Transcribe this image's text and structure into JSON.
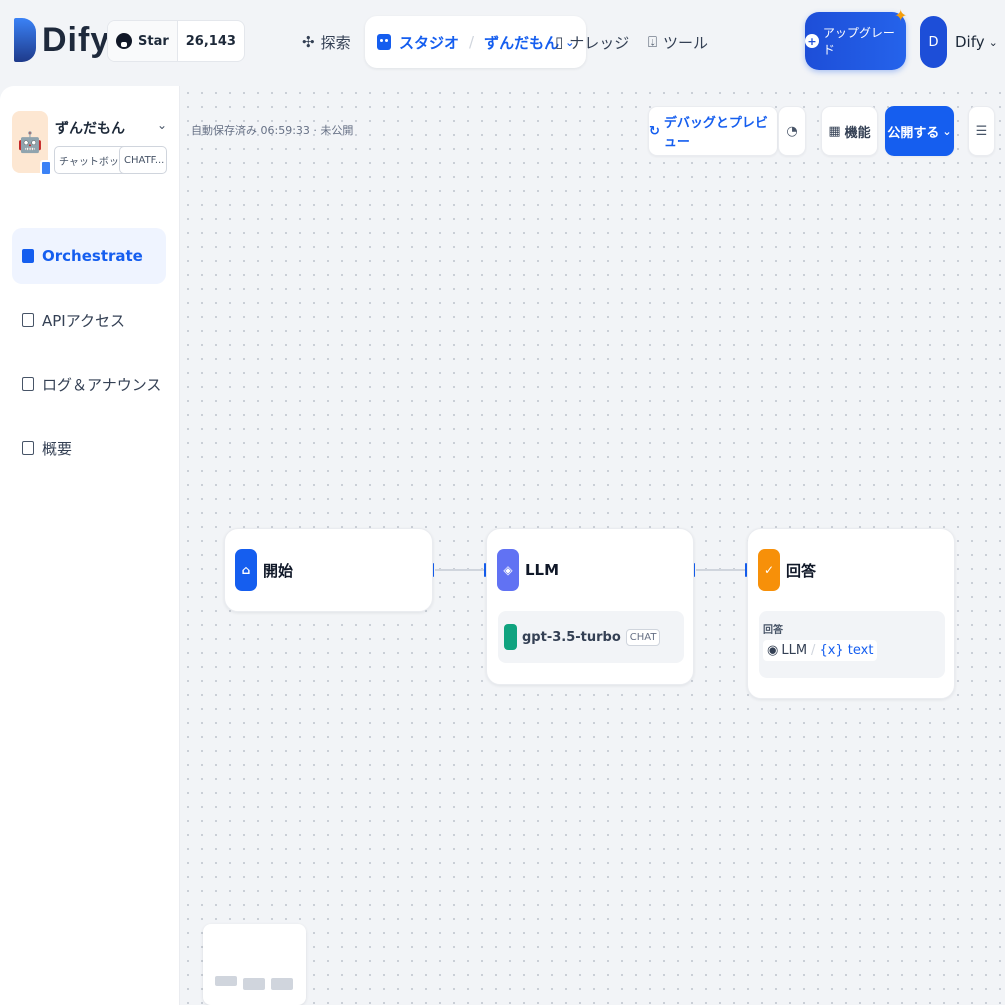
{
  "header": {
    "logo_text": "Dify",
    "github": {
      "star_label": "Star",
      "count": "26,143"
    },
    "nav": {
      "explore": "探索",
      "studio": "スタジオ",
      "studio_app": "ずんだもん",
      "knowledge": "ナレッジ",
      "tools": "ツール"
    },
    "upgrade_label": "アップグレード",
    "account": {
      "initial": "D",
      "name": "Dify"
    }
  },
  "sidebar": {
    "app_name": "ずんだもん",
    "app_type": "チャットボット",
    "app_mode": "CHATF...",
    "items": [
      {
        "label": "Orchestrate",
        "active": true
      },
      {
        "label": "APIアクセス",
        "active": false
      },
      {
        "label": "ログ＆アナウンス",
        "active": false
      },
      {
        "label": "概要",
        "active": false
      }
    ]
  },
  "toolbar": {
    "autosave": "自動保存済み 06:59:33 · 未公開",
    "debug_label": "デバッグとプレビュー",
    "features_label": "機能",
    "publish_label": "公開する"
  },
  "workflow": {
    "start": {
      "title": "開始"
    },
    "llm": {
      "title": "LLM",
      "model": "gpt-3.5-turbo",
      "mode_tag": "CHAT"
    },
    "answer": {
      "title": "回答",
      "field_label": "回答",
      "source_node": "LLM",
      "variable": "{x} text"
    }
  },
  "colors": {
    "primary": "#155eef",
    "llm_icon": "#6172f3",
    "answer_icon": "#f79009",
    "openai": "#10a37f"
  },
  "icons": [
    "github-icon",
    "explore-icon",
    "studio-icon",
    "knowledge-icon",
    "tools-icon",
    "upgrade-icon",
    "orchestrate-icon",
    "api-icon",
    "log-icon",
    "overview-icon",
    "debug-icon",
    "history-icon",
    "features-icon",
    "checklist-icon",
    "home-icon",
    "llm-icon",
    "answer-icon",
    "openai-icon"
  ]
}
